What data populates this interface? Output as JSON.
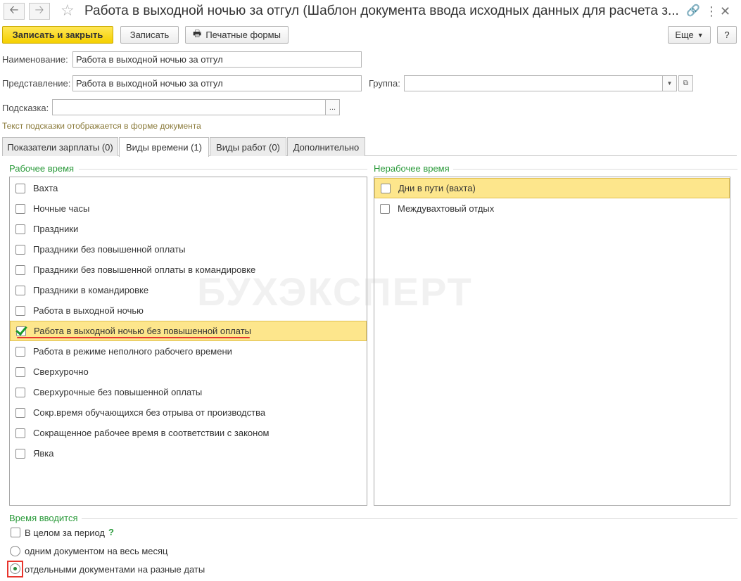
{
  "window": {
    "title": "Работа в выходной ночью за отгул (Шаблон документа ввода исходных данных для расчета з...",
    "back_icon": "arrow-left-icon",
    "forward_icon": "arrow-right-icon",
    "favorite_icon": "star-icon"
  },
  "toolbar": {
    "save_close_label": "Записать и закрыть",
    "save_label": "Записать",
    "print_label": "Печатные формы",
    "more_label": "Еще",
    "help_label": "?"
  },
  "form": {
    "name_label": "Наименование:",
    "name_value": "Работа в выходной ночью за отгул",
    "presentation_label": "Представление:",
    "presentation_value": "Работа в выходной ночью за отгул",
    "group_label": "Группа:",
    "group_value": "",
    "hint_label": "Подсказка:",
    "hint_value": "",
    "hint_note": "Текст подсказки отображается в форме документа"
  },
  "tabs": [
    {
      "label": "Показатели зарплаты (0)",
      "active": false
    },
    {
      "label": "Виды времени (1)",
      "active": true
    },
    {
      "label": "Виды работ (0)",
      "active": false
    },
    {
      "label": "Дополнительно",
      "active": false
    }
  ],
  "working_time": {
    "caption": "Рабочее время",
    "items": [
      {
        "label": "Вахта",
        "checked": false,
        "selected": false
      },
      {
        "label": "Ночные часы",
        "checked": false,
        "selected": false
      },
      {
        "label": "Праздники",
        "checked": false,
        "selected": false
      },
      {
        "label": "Праздники без повышенной оплаты",
        "checked": false,
        "selected": false
      },
      {
        "label": "Праздники без повышенной оплаты в командировке",
        "checked": false,
        "selected": false
      },
      {
        "label": "Праздники в командировке",
        "checked": false,
        "selected": false
      },
      {
        "label": "Работа в выходной ночью",
        "checked": false,
        "selected": false
      },
      {
        "label": "Работа в выходной ночью без повышенной оплаты",
        "checked": true,
        "selected": true
      },
      {
        "label": "Работа в режиме неполного рабочего времени",
        "checked": false,
        "selected": false
      },
      {
        "label": "Сверхурочно",
        "checked": false,
        "selected": false
      },
      {
        "label": "Сверхурочные без повышенной оплаты",
        "checked": false,
        "selected": false
      },
      {
        "label": "Сокр.время обучающихся без отрыва от производства",
        "checked": false,
        "selected": false
      },
      {
        "label": "Сокращенное рабочее время в соответствии с законом",
        "checked": false,
        "selected": false
      },
      {
        "label": "Явка",
        "checked": false,
        "selected": false
      }
    ]
  },
  "non_working_time": {
    "caption": "Нерабочее время",
    "items": [
      {
        "label": "Дни в пути (вахта)",
        "checked": false,
        "selected": true
      },
      {
        "label": "Междувахтовый отдых",
        "checked": false,
        "selected": false
      }
    ]
  },
  "time_entry": {
    "caption": "Время вводится",
    "whole_period_label": "В целом за период",
    "whole_period_checked": false,
    "help_mark": "?",
    "option_month": "одним документом на весь месяц",
    "option_dates": "отдельными документами на разные даты",
    "selected_option": "dates"
  },
  "watermark_text": "БУХЭКСПЕРТ"
}
